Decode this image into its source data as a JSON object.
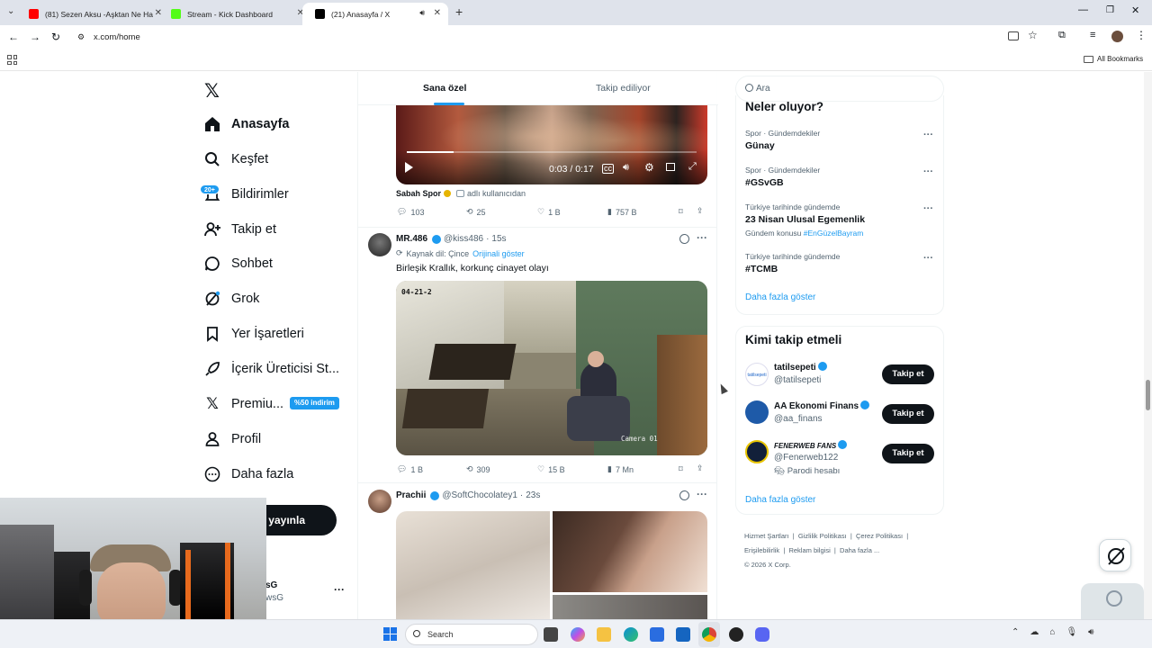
{
  "browser": {
    "tabs": [
      {
        "title": "(81) Sezen Aksu -Aşktan Ne Ha",
        "color": "#ff0000"
      },
      {
        "title": "Stream - Kick Dashboard",
        "color": "#53fc18"
      },
      {
        "title": "(21) Anasayfa / X",
        "color": "#000000"
      }
    ],
    "url": "x.com/home",
    "bookmarks_label": "All Bookmarks"
  },
  "sidebar": {
    "items": [
      {
        "label": "Anasayfa",
        "icon": "home-icon"
      },
      {
        "label": "Keşfet",
        "icon": "search-icon"
      },
      {
        "label": "Bildirimler",
        "icon": "bell-icon",
        "badge": "20+"
      },
      {
        "label": "Takip et",
        "icon": "add-user-icon"
      },
      {
        "label": "Sohbet",
        "icon": "chat-icon"
      },
      {
        "label": "Grok",
        "icon": "grok-icon"
      },
      {
        "label": "Yer İşaretleri",
        "icon": "bookmark-icon"
      },
      {
        "label": "İçerik Üreticisi St...",
        "icon": "rocket-icon"
      },
      {
        "label": "Premiu...",
        "icon": "x-logo-icon",
        "badge": "%50 indirim"
      },
      {
        "label": "Profil",
        "icon": "profile-icon"
      },
      {
        "label": "Daha fazla",
        "icon": "more-circle-icon"
      }
    ],
    "post_button": "i yayınla",
    "account_name": "sG",
    "account_handle": "wsG"
  },
  "feed": {
    "tabs": [
      "Sana özel",
      "Takip ediliyor"
    ],
    "post1": {
      "video_time": "0:03 / 0:17",
      "source": "Sabah Spor",
      "source_note": "adlı kullanıcıdan",
      "replies": "103",
      "reposts": "25",
      "likes": "1 B",
      "views": "757 B"
    },
    "post2": {
      "name": "MR.486",
      "handle": "@kiss486",
      "time": "15s",
      "source_lang": "Kaynak dil: Çince",
      "show_original": "Orijinali göster",
      "text": "Birleşik Krallık, korkunç cinayet olayı",
      "cam_stamp": "04-21-2",
      "cam_label": "Camera 01",
      "replies": "1 B",
      "reposts": "309",
      "likes": "15 B",
      "views": "7 Mn"
    },
    "post3": {
      "name": "Prachii",
      "handle": "@SoftChocolatey1",
      "time": "23s"
    }
  },
  "search": {
    "placeholder": "Ara"
  },
  "trends": {
    "title": "Neler oluyor?",
    "items": [
      {
        "context": "Spor · Gündemdekiler",
        "name": "Günay"
      },
      {
        "context": "Spor · Gündemdekiler",
        "name": "#GSvGB"
      },
      {
        "context": "Türkiye tarihinde gündemde",
        "name": "23 Nisan Ulusal Egemenlik",
        "extra": "Gündem konusu",
        "extra_tag": "#EnGüzelBayram"
      },
      {
        "context": "Türkiye tarihinde gündemde",
        "name": "#TCMB"
      }
    ],
    "show_more": "Daha fazla göster"
  },
  "who_to_follow": {
    "title": "Kimi takip etmeli",
    "users": [
      {
        "name": "tatilsepeti",
        "handle": "@tatilsepeti",
        "button": "Takip et"
      },
      {
        "name": "AA Ekonomi Finans",
        "handle": "@aa_finans",
        "button": "Takip et"
      },
      {
        "name": "FENERWEB FANS",
        "handle": "@Fenerweb122",
        "note": "Parodi hesabı",
        "button": "Takip et"
      }
    ],
    "show_more": "Daha fazla göster"
  },
  "footer": {
    "links": [
      "Hizmet Şartları",
      "Gizlilik Politikası",
      "Çerez Politikası",
      "Erişilebilirlik",
      "Reklam bilgisi",
      "Daha fazla ..."
    ],
    "copyright": "© 2026 X Corp."
  },
  "taskbar": {
    "search_label": "Search"
  }
}
